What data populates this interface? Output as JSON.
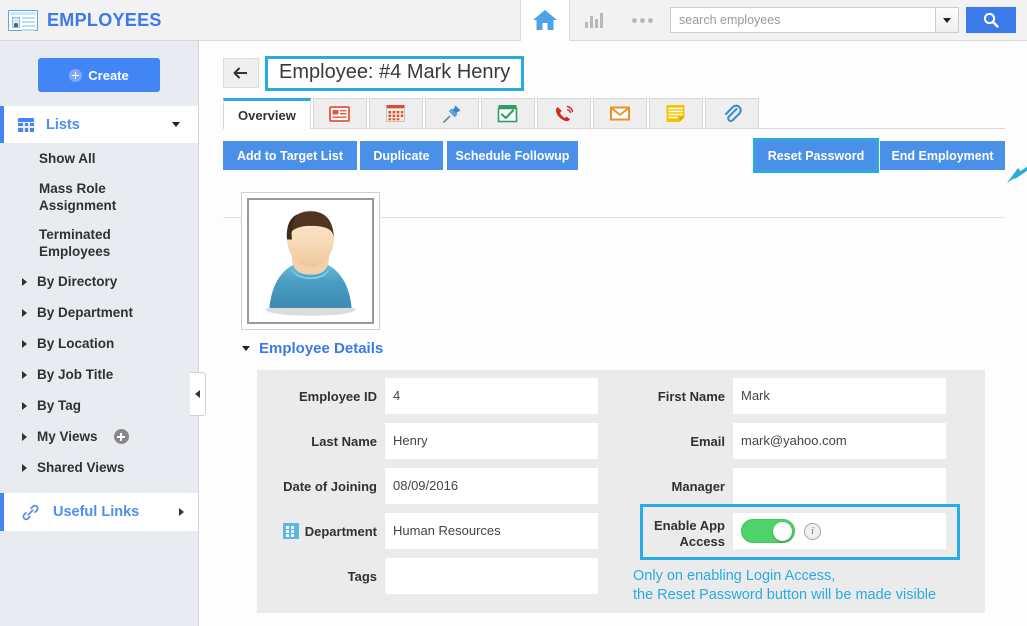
{
  "app": {
    "title": "EMPLOYEES",
    "logo_icon": "id-card-icon"
  },
  "header": {
    "home_icon": "home-icon",
    "reports_icon": "bar-chart-icon",
    "more_icon": "more-dots-icon",
    "search": {
      "placeholder": "search employees",
      "value": "",
      "dropdown_icon": "chevron-down-icon",
      "submit_icon": "search-icon"
    }
  },
  "sidebar": {
    "create_label": "Create",
    "lists": {
      "label": "Lists",
      "icon": "grid-icon",
      "expanded": true
    },
    "items": [
      {
        "label": "Show All",
        "type": "link"
      },
      {
        "label": "Mass Role Assignment",
        "type": "link"
      },
      {
        "label": "Terminated Employees",
        "type": "link"
      },
      {
        "label": "By Directory",
        "type": "expandable"
      },
      {
        "label": "By Department",
        "type": "expandable"
      },
      {
        "label": "By Location",
        "type": "expandable"
      },
      {
        "label": "By Job Title",
        "type": "expandable"
      },
      {
        "label": "By Tag",
        "type": "expandable"
      },
      {
        "label": "My Views",
        "type": "expandable",
        "add_button": true
      },
      {
        "label": "Shared Views",
        "type": "expandable"
      }
    ],
    "useful_links": {
      "label": "Useful Links",
      "icon": "link-icon"
    },
    "collapse_icon": "chevron-left-icon"
  },
  "main": {
    "back_icon": "back-arrow-icon",
    "page_title": "Employee: #4 Mark Henry",
    "tabs": [
      {
        "label": "Overview",
        "active": true,
        "icon": null
      },
      {
        "label": "",
        "active": false,
        "icon": "news-list-icon"
      },
      {
        "label": "",
        "active": false,
        "icon": "calendar-icon"
      },
      {
        "label": "",
        "active": false,
        "icon": "pin-icon"
      },
      {
        "label": "",
        "active": false,
        "icon": "task-calendar-icon"
      },
      {
        "label": "",
        "active": false,
        "icon": "phone-call-icon"
      },
      {
        "label": "",
        "active": false,
        "icon": "envelope-icon"
      },
      {
        "label": "",
        "active": false,
        "icon": "notes-icon"
      },
      {
        "label": "",
        "active": false,
        "icon": "paperclip-icon"
      }
    ],
    "actions_left": [
      {
        "label": "Add to Target List",
        "highlighted": false
      },
      {
        "label": "Duplicate",
        "highlighted": false
      },
      {
        "label": "Schedule Followup",
        "highlighted": false
      }
    ],
    "actions_right": [
      {
        "label": "Reset Password",
        "highlighted": true
      },
      {
        "label": "End Employment",
        "highlighted": false
      }
    ],
    "avatar": {
      "icon": "user-avatar-icon"
    },
    "details_section": {
      "label": "Employee Details",
      "toggle_icon": "chevron-down-icon",
      "expanded": true
    },
    "form": {
      "left_fields": [
        {
          "label": "Employee ID",
          "value": "4",
          "icon": null
        },
        {
          "label": "Last Name",
          "value": "Henry",
          "icon": null
        },
        {
          "label": "Date of Joining",
          "value": "08/09/2016",
          "icon": null
        },
        {
          "label": "Department",
          "value": "Human Resources",
          "icon": "building-icon"
        },
        {
          "label": "Tags",
          "value": "",
          "icon": null
        }
      ],
      "right_fields": [
        {
          "label": "First Name",
          "value": "Mark",
          "icon": null
        },
        {
          "label": "Email",
          "value": "mark@yahoo.com",
          "icon": null
        },
        {
          "label": "Manager",
          "value": "",
          "icon": null
        }
      ],
      "app_access": {
        "label_line1": "Enable App",
        "label_line2": "Access",
        "enabled": true,
        "info_icon": "info-icon",
        "info_glyph": "i"
      }
    },
    "annotation": {
      "line1": "Only on enabling Login Access,",
      "line2": "the Reset Password button will be made visible",
      "arrow_icon": "annotation-arrow-icon"
    }
  },
  "colors": {
    "brand_blue": "#3b7ae8",
    "accent_cyan": "#29abe2",
    "button_blue": "#4a90e8",
    "create_blue": "#4285f4",
    "toggle_green": "#4fd26a",
    "sidebar_bg": "#e8ecf1",
    "panel_bg": "#ebebeb"
  }
}
